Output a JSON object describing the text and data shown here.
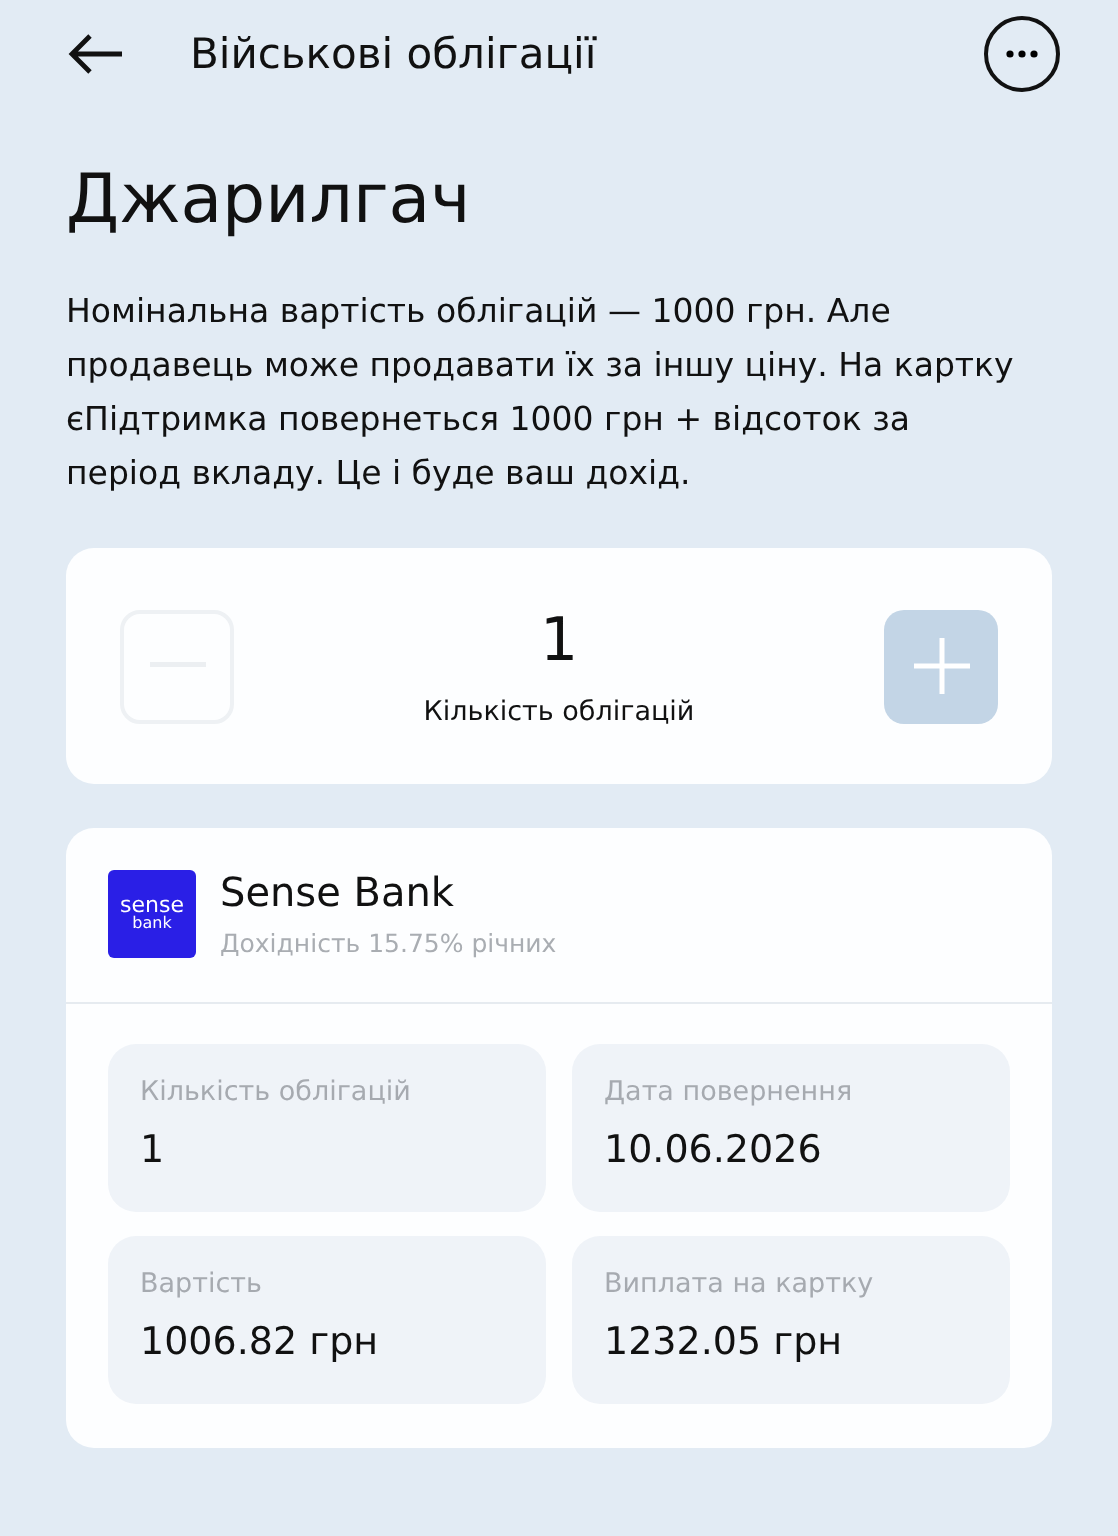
{
  "header": {
    "title": "Військові облігації"
  },
  "heading": "Джарилгач",
  "description": "Номінальна вартість облігацій — 1000 грн. Але продавець може продавати їх за іншу ціну. На картку єПідтримка повернеться 1000 грн + відсоток за період вкладу. Це і буде ваш дохід.",
  "counter": {
    "value": "1",
    "label": "Кількість облігацій",
    "decrease_disabled": true,
    "increase_disabled": false
  },
  "offer": {
    "logo": {
      "line_1": "sense",
      "line_2": "bank"
    },
    "bank": "Sense Bank",
    "yield": "Дохідність 15.75% річних",
    "details": [
      {
        "label": "Кількість облігацій",
        "value": "1"
      },
      {
        "label": "Дата повернення",
        "value": "10.06.2026"
      },
      {
        "label": "Вартість",
        "value": "1006.82 грн"
      },
      {
        "label": "Виплата на картку",
        "value": "1232.05 грн"
      }
    ]
  }
}
